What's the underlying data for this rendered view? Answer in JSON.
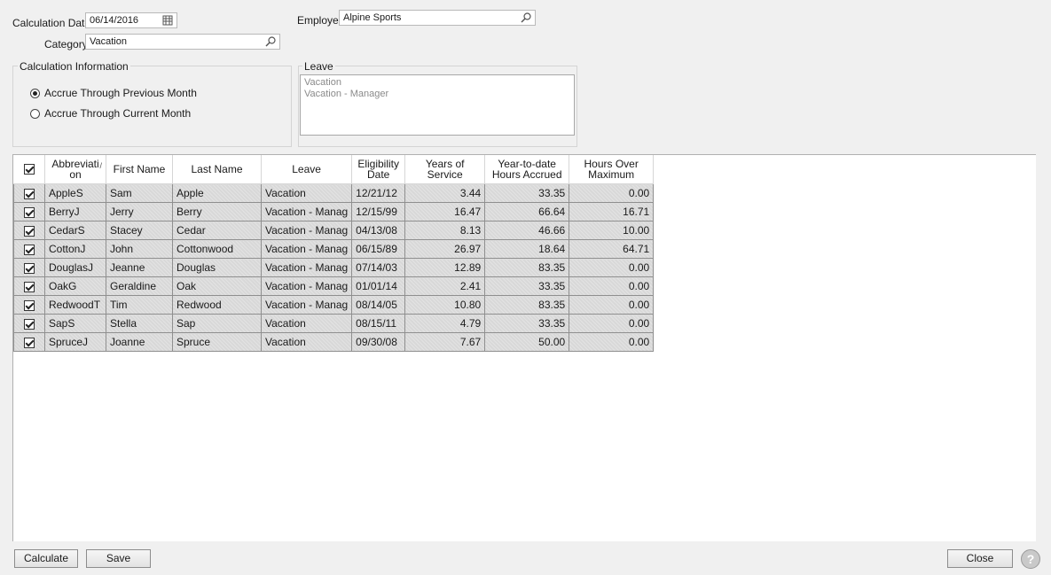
{
  "form": {
    "calc_date_label": "Calculation Date",
    "calc_date_value": "06/14/2016",
    "category_label": "Category",
    "category_value": "Vacation",
    "employer_label": "Employer",
    "employer_value": "Alpine Sports"
  },
  "calc_info": {
    "title": "Calculation Information",
    "options": [
      {
        "label": "Accrue Through Previous Month",
        "selected": true
      },
      {
        "label": "Accrue Through Current Month",
        "selected": false
      }
    ]
  },
  "leave": {
    "title": "Leave",
    "items": [
      "Vacation",
      "Vacation - Manager"
    ]
  },
  "grid": {
    "columns": [
      {
        "line1": "Abbreviati",
        "line2": "on"
      },
      {
        "line1": "First Name",
        "line2": ""
      },
      {
        "line1": "Last Name",
        "line2": ""
      },
      {
        "line1": "Leave",
        "line2": ""
      },
      {
        "line1": "Eligibility",
        "line2": "Date"
      },
      {
        "line1": "Years of Service",
        "line2": ""
      },
      {
        "line1": "Year-to-date",
        "line2": "Hours Accrued"
      },
      {
        "line1": "Hours Over",
        "line2": "Maximum"
      }
    ],
    "rows": [
      {
        "checked": true,
        "abbr": "AppleS",
        "first": "Sam",
        "last": "Apple",
        "leave": "Vacation",
        "elig": "12/21/12",
        "years": "3.44",
        "accrued": "33.35",
        "over": "0.00"
      },
      {
        "checked": true,
        "abbr": "BerryJ",
        "first": "Jerry",
        "last": "Berry",
        "leave": "Vacation - Manag",
        "elig": "12/15/99",
        "years": "16.47",
        "accrued": "66.64",
        "over": "16.71"
      },
      {
        "checked": true,
        "abbr": "CedarS",
        "first": "Stacey",
        "last": "Cedar",
        "leave": "Vacation - Manag",
        "elig": "04/13/08",
        "years": "8.13",
        "accrued": "46.66",
        "over": "10.00"
      },
      {
        "checked": true,
        "abbr": "CottonJ",
        "first": "John",
        "last": "Cottonwood",
        "leave": "Vacation - Manag",
        "elig": "06/15/89",
        "years": "26.97",
        "accrued": "18.64",
        "over": "64.71"
      },
      {
        "checked": true,
        "abbr": "DouglasJ",
        "first": "Jeanne",
        "last": "Douglas",
        "leave": "Vacation - Manag",
        "elig": "07/14/03",
        "years": "12.89",
        "accrued": "83.35",
        "over": "0.00"
      },
      {
        "checked": true,
        "abbr": "OakG",
        "first": "Geraldine",
        "last": "Oak",
        "leave": "Vacation - Manag",
        "elig": "01/01/14",
        "years": "2.41",
        "accrued": "33.35",
        "over": "0.00"
      },
      {
        "checked": true,
        "abbr": "RedwoodT",
        "first": "Tim",
        "last": "Redwood",
        "leave": "Vacation - Manag",
        "elig": "08/14/05",
        "years": "10.80",
        "accrued": "83.35",
        "over": "0.00"
      },
      {
        "checked": true,
        "abbr": "SapS",
        "first": "Stella",
        "last": "Sap",
        "leave": "Vacation",
        "elig": "08/15/11",
        "years": "4.79",
        "accrued": "33.35",
        "over": "0.00"
      },
      {
        "checked": true,
        "abbr": "SpruceJ",
        "first": "Joanne",
        "last": "Spruce",
        "leave": "Vacation",
        "elig": "09/30/08",
        "years": "7.67",
        "accrued": "50.00",
        "over": "0.00"
      }
    ]
  },
  "buttons": {
    "calculate": "Calculate",
    "save": "Save",
    "close": "Close",
    "help": "?"
  },
  "icons": {
    "date_picker": "calendar-icon",
    "lookup": "search-icon",
    "help": "help-icon"
  }
}
